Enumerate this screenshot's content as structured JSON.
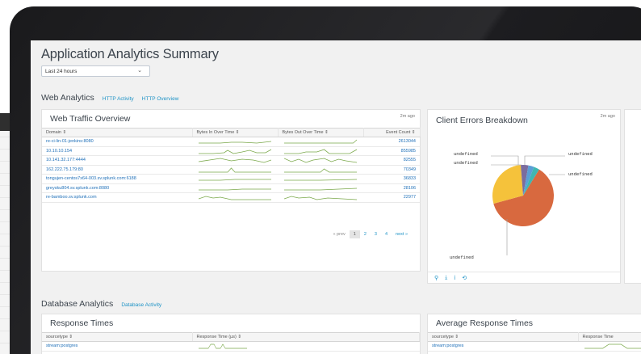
{
  "app": {
    "title": "Application Analytics Summary",
    "time_range": "Last 24 hours"
  },
  "web_section": {
    "title": "Web Analytics",
    "links": [
      "HTTP Activity",
      "HTTP Overview"
    ]
  },
  "web_traffic": {
    "title": "Web Traffic Overview",
    "age": "2m ago",
    "columns": [
      "Domain ⇕",
      "Bytes In Over Time ⇕",
      "Bytes Out Over Time ⇕",
      "Event Count ⇕"
    ],
    "rows": [
      {
        "domain": "re-ci-lin-01-jenkins:8080",
        "count": "2613044"
      },
      {
        "domain": "10.10.10.154",
        "count": "855985"
      },
      {
        "domain": "10.141.32.177:4444",
        "count": "82555"
      },
      {
        "domain": "162.222.75.179:80",
        "count": "70349"
      },
      {
        "domain": "tongujen-centos7x64-003.sv.splunk.com:6188",
        "count": "36833"
      },
      {
        "domain": "greysku804.sv.splunk.com:8080",
        "count": "28106"
      },
      {
        "domain": "re-bamboo.sv.splunk.com",
        "count": "22977"
      }
    ],
    "pager": {
      "prev": "« prev",
      "pages": [
        "1",
        "2",
        "3",
        "4"
      ],
      "next": "next »",
      "current": "1"
    }
  },
  "client_errors": {
    "title": "Client Errors Breakdown",
    "age": "2m ago",
    "labels": [
      "undefined",
      "undefined",
      "undefined",
      "undefined",
      "undefined"
    ],
    "colors": {
      "orange": "#d8693f",
      "yellow": "#f5c23b",
      "purple": "#7b6c9e",
      "blue": "#5a9ed6",
      "teal": "#3fb6b1"
    },
    "slices": [
      {
        "color": "#d8693f",
        "value": 0.62
      },
      {
        "color": "#f5c23b",
        "value": 0.28
      },
      {
        "color": "#7b6c9e",
        "value": 0.04
      },
      {
        "color": "#5a9ed6",
        "value": 0.03
      },
      {
        "color": "#3fb6b1",
        "value": 0.03
      }
    ],
    "footer_icons": [
      "search-icon",
      "export-icon",
      "info-icon",
      "refresh-icon"
    ],
    "footer_glyphs": [
      "⚲",
      "⤓",
      "ⅰ",
      "⟲"
    ]
  },
  "db_section": {
    "title": "Database Analytics",
    "links": [
      "Database Activity"
    ]
  },
  "response_times": {
    "title": "Response Times",
    "columns": [
      "sourcetype ⇕",
      "Response Time (µs) ⇕"
    ],
    "rows": [
      {
        "sourcetype": "stream:postgres"
      }
    ]
  },
  "avg_response_times": {
    "title": "Average Response Times",
    "columns": [
      "sourcetype ⇕",
      "Response Time"
    ],
    "rows": [
      {
        "sourcetype": "stream:postgres"
      }
    ]
  }
}
